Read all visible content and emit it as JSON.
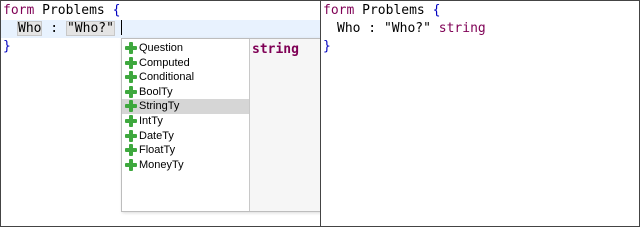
{
  "left_editor": {
    "line1": {
      "kw": "form",
      "name": " Problems ",
      "brace": "{"
    },
    "line2": {
      "id": "Who",
      "sep": " : ",
      "label": "\"Who?\""
    },
    "line3": {
      "brace": "}"
    }
  },
  "right_editor": {
    "line1": {
      "kw": "form",
      "name": " Problems ",
      "brace": "{"
    },
    "line2": {
      "id": "Who",
      "sep": " : ",
      "label": "\"Who?\"",
      "type": "string"
    },
    "line3": {
      "brace": "}"
    }
  },
  "autocomplete": {
    "items": [
      {
        "label": "Question"
      },
      {
        "label": "Computed"
      },
      {
        "label": "Conditional"
      },
      {
        "label": "BoolTy"
      },
      {
        "label": "StringTy"
      },
      {
        "label": "IntTy"
      },
      {
        "label": "DateTy"
      },
      {
        "label": "FloatTy"
      },
      {
        "label": "MoneyTy"
      }
    ],
    "selected_index": 4,
    "info_text": "string",
    "icon": "plus-icon"
  }
}
